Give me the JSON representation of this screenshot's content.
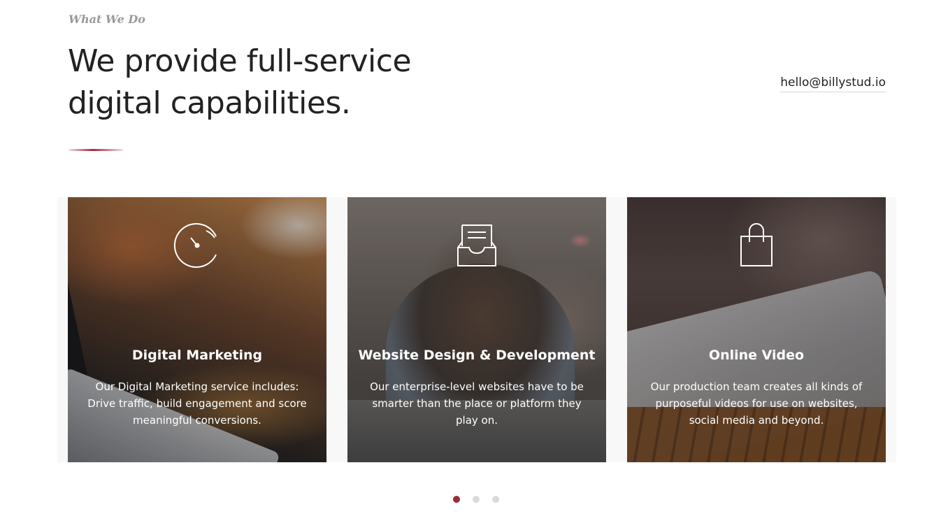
{
  "section": {
    "eyebrow": "What We Do",
    "headline": "We provide full-service digital capabilities.",
    "email": "hello@billystud.io"
  },
  "cards": [
    {
      "icon": "speedometer-icon",
      "title": "Digital Marketing",
      "text": "Our Digital Marketing service includes: Drive traffic, build engagement and score meaningful conversions."
    },
    {
      "icon": "inbox-tray-icon",
      "title": "Website Design & Development",
      "text": "Our enterprise-level websites have to be smarter than the place or platform they play on."
    },
    {
      "icon": "shopping-bag-icon",
      "title": "Online Video",
      "text": "Our production team creates all kinds of purposeful videos for use on websites, social media and beyond."
    }
  ],
  "pagination": {
    "total": 3,
    "active_index": 0
  },
  "colors": {
    "accent": "#9b2b37",
    "heading": "#222222",
    "eyebrow": "#9a9a9a",
    "dot_inactive": "#dadada"
  }
}
